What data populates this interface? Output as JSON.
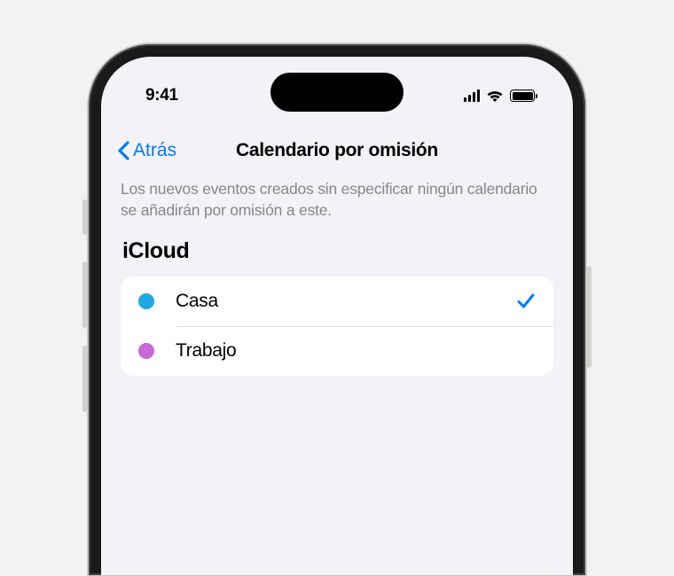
{
  "statusBar": {
    "time": "9:41"
  },
  "nav": {
    "back": "Atrás",
    "title": "Calendario por omisión"
  },
  "description": "Los nuevos eventos creados sin especificar ningún calendario se añadirán por omisión a este.",
  "section": {
    "header": "iCloud",
    "items": [
      {
        "label": "Casa",
        "color": "#1ea9e1",
        "selected": true
      },
      {
        "label": "Trabajo",
        "color": "#c867d8",
        "selected": false
      }
    ]
  }
}
